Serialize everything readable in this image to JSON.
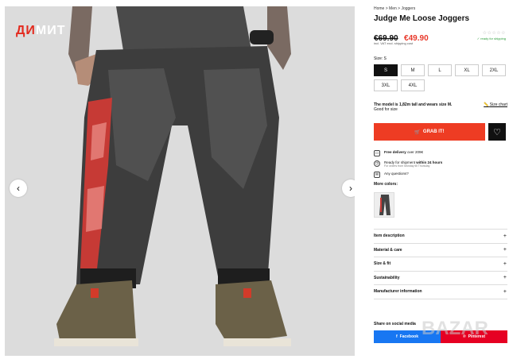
{
  "gallery": {
    "logo_part1": "ДИ",
    "logo_part2": "МИТ",
    "prev_icon": "‹",
    "next_icon": "›"
  },
  "product": {
    "breadcrumb": "Home > Men > Joggers",
    "title": "Judge Me Loose Joggers",
    "old_price": "€69.90",
    "new_price": "€49.90",
    "rating_stars": "☆☆☆☆☆",
    "stock_text": "✓ ready for shipping",
    "vat_text": "incl. VAT excl. shipping cost",
    "size_label": "Size: S",
    "sizes": [
      "S",
      "M",
      "L",
      "XL",
      "2XL",
      "3XL",
      "4XL"
    ],
    "selected_size": "S",
    "model_line": "The model is 1,82m tall and wears size M.",
    "fit_line": "Good for size",
    "size_chart": "Size chart",
    "buy_label": "GRAB IT!",
    "delivery_text": "Free delivery",
    "delivery_rest": " over 209€",
    "shipment_text": "Ready for shipment ",
    "shipment_bold": "within 24 hours",
    "shipment_sub": "For orders from Monday till Thursday",
    "questions": "Any questions?",
    "more_colors": "More colors:",
    "accordion": [
      "Item description",
      "Material & care",
      "Size & fit",
      "Sustainability",
      "Manufacturer information"
    ],
    "share_label": "Share on social media",
    "facebook": "Facebook",
    "pinterest": "Pinterest"
  },
  "watermark": "BAZAR",
  "colors": {
    "accent": "#ee3c23",
    "price_red": "#e8382a",
    "facebook": "#1877f2",
    "pinterest": "#e60023"
  }
}
